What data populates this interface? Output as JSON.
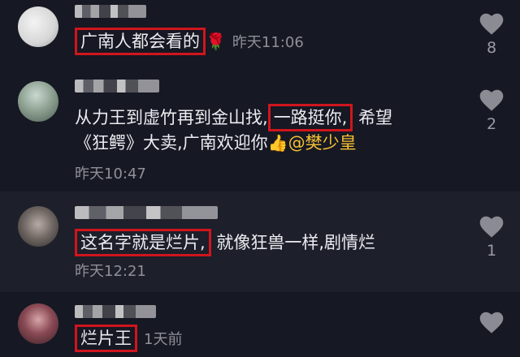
{
  "comments": [
    {
      "text_boxed": "广南人都会看的",
      "emoji": "🌹",
      "time": "昨天11:06",
      "likes": "8"
    },
    {
      "line1_pre": "从力王到虚竹再到金山找,",
      "line1_boxed": "一路挺你,",
      "line1_post": "希望",
      "line2_pre": "《狂鳄》大卖,广南欢迎你",
      "emoji": "👍",
      "mention": "@樊少皇",
      "time": "昨天10:47",
      "likes": "2"
    },
    {
      "text_boxed": "这名字就是烂片,",
      "text_post": "就像狂兽一样,剧情烂",
      "time": "昨天12:21",
      "likes": "1"
    },
    {
      "text_boxed": "烂片王",
      "time": "1天前"
    }
  ]
}
